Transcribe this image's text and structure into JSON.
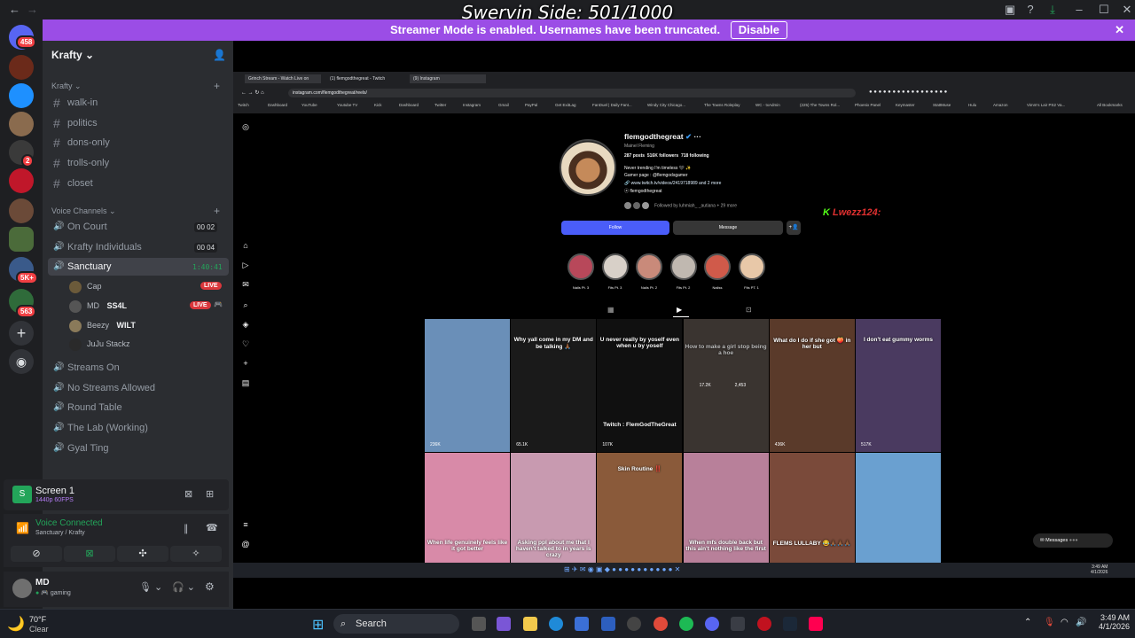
{
  "overlay": {
    "title": "Swervin Side: 501/1000"
  },
  "banner": {
    "text": "Streamer Mode is enabled. Usernames have been truncated.",
    "button": "Disable"
  },
  "server_badges": [
    "458",
    "2",
    "5K+",
    "563"
  ],
  "guild": {
    "name": "Krafty"
  },
  "categories": {
    "text": "Krafty",
    "voice": "Voice Channels"
  },
  "text_channels": [
    "walk-in",
    "politics",
    "dons-only",
    "trolls-only",
    "closet"
  ],
  "voice_channels": [
    {
      "name": "On Court",
      "a": "00",
      "b": "02"
    },
    {
      "name": "Krafty Individuals",
      "a": "00",
      "b": "04"
    },
    {
      "name": "Sanctuary",
      "timer": "1:40:41"
    }
  ],
  "members": [
    {
      "name": "Cap",
      "live": "LIVE"
    },
    {
      "name": "MD",
      "tag": "SS4L",
      "live": "LIVE"
    },
    {
      "name": "Beezy",
      "tag": "WILT"
    },
    {
      "name": "JuJu Stackz"
    }
  ],
  "more_channels": [
    "Streams On",
    "No Streams Allowed",
    "Round Table",
    "The Lab (Working)",
    "Gyal Ting"
  ],
  "screen_share": {
    "title": "Screen 1",
    "quality": "1440p 60FPS"
  },
  "voice": {
    "status": "Voice Connected",
    "location": "Sanctuary / Krafty"
  },
  "user": {
    "name": "MD",
    "status": "gaming"
  },
  "browser": {
    "tabs": [
      "Grinch Stream - Watch Live on",
      "(1) flemgodthegreat - Twitch",
      "(9) Instagram"
    ],
    "url": "instagram.com/flemgodthegreat/reels/",
    "bookmarks": [
      "Twitch",
      "Dashboard",
      "YouTube",
      "Youtube TV",
      "Kick",
      "Dashboard",
      "Twitter",
      "Instagram",
      "Gmail",
      "PayPal",
      "Get ExitLag",
      "FanDuel | Daily Fant...",
      "Windy City Chicago...",
      "The Towns Roleplay",
      "WC - txAdmin",
      "(225) The Towns Rol...",
      "Phoenix Panel",
      "Keymaster",
      "StattMuse",
      "Hulu",
      "Amazon",
      "Vimm's Lair PS2 Va..."
    ],
    "all_bookmarks": "All Bookmarks"
  },
  "profile": {
    "username": "flemgodthegreat",
    "fullname": "Mainel Fleming",
    "posts": "287 posts",
    "followers": "516K followers",
    "following": "718 following",
    "bio1": "Never trending I'm timeless 🖤 ✨",
    "bio2": "Gamer page : @flemgodsgamer",
    "link": "www.twitch.tv/videos/2419718989 and 2 more",
    "handle": "flemgodthegreat",
    "followed_by": "Followed by luhmiah_ _autiana + 29 more",
    "follow_btn": "Follow",
    "message_btn": "Message"
  },
  "alert": {
    "text": "Lwezz124:"
  },
  "highlights": [
    "Nails Pt. 3",
    "Fits Pt. 3",
    "Nails Pt. 2",
    "Fits Pt. 2",
    "Nailss",
    "Fits PT. 1"
  ],
  "reels_row1": [
    {
      "caption": "",
      "views": "236K"
    },
    {
      "caption": "Why yall come in my DM and be talking 🙏🏾",
      "views": "65.1K"
    },
    {
      "caption": "U never really by yoself even when u by yoself",
      "views": "107K",
      "sub": "Twitch : FlemGodTheGreat"
    },
    {
      "caption": "How to make a girl stop being a hoe",
      "likes": "17.2K",
      "comments": "2,453"
    },
    {
      "caption": "What do I do if she got 🍑 in her but",
      "views": "436K"
    },
    {
      "caption": "I don't eat gummy worms",
      "views": "517K"
    }
  ],
  "reels_row2": [
    {
      "caption": "When life genuinely feels like it got better"
    },
    {
      "caption": "Asking ppl about me that I haven't talked to in years is crazy"
    },
    {
      "caption": "Skin Routine ‼️"
    },
    {
      "caption": "When mfs double back but this ain't nothing like the first"
    },
    {
      "caption": "FLEMS LULLABY 😂🙏🏾🙏🏾🙏🏾"
    },
    {
      "caption": ""
    }
  ],
  "messages": {
    "label": "Messages"
  },
  "inner_clock": {
    "time": "3:49 AM",
    "date": "4/1/2026"
  },
  "weather": {
    "temp": "70°F",
    "desc": "Clear"
  },
  "taskbar": {
    "search": "Search",
    "time": "3:49 AM",
    "date": "4/1/2026"
  }
}
